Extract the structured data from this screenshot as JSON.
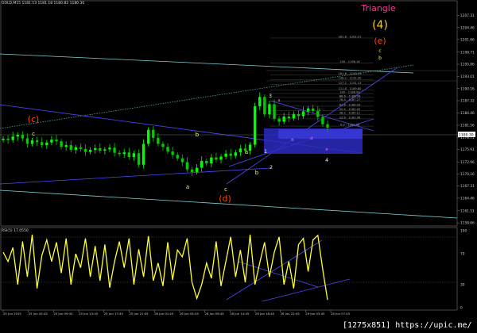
{
  "header": {
    "caption": "GOLD,M15  1181.13 1181.18 1180.82 1180.30"
  },
  "rsi": {
    "caption": "RSI(5) 17.0550"
  },
  "watermark": "[1275x851] https://upic.me/",
  "colors": {
    "background": "#000000",
    "bull_candle": "#00ff00",
    "bear_candle": "#00cc00",
    "rsi_line": "#ffff33",
    "channel_line": "#4a4aff",
    "long_trend": "#7fd0d0",
    "highlight_box": "#2b2bbf",
    "triangle_label": "#ff3399",
    "wave_4": "#ffcc00",
    "wave_abc": "#e0ff66",
    "wave_degree_paren": "#ff4500",
    "price_tag_bg": "#ffffff"
  },
  "chart_data": {
    "type": "line",
    "symbol": "GOLD",
    "timeframe": "M15",
    "price_axis": {
      "ylim": [
        1158.5,
        1210.0
      ],
      "ticks": [
        "1207.31",
        "1204.46",
        "1201.66",
        "1198.71",
        "1195.86",
        "1193.01",
        "1190.16",
        "1187.32",
        "1184.46",
        "1181.56",
        "1178.71",
        "1175.91",
        "1172.96",
        "1170.16",
        "1167.31",
        "1164.46",
        "1161.51",
        "1158.66"
      ],
      "current_price": "1180.30"
    },
    "time_axis": {
      "ticks": [
        "25 Jun 2015",
        "25 Jun 05:45",
        "25 Jun 09:45",
        "25 Jun 13:45",
        "25 Jun 17:45",
        "25 Jun 21:45",
        "26 Jun 01:45",
        "26 Jun 05:45",
        "26 Jun 09:45",
        "26 Jun 14:45",
        "26 Jun 18:45",
        "26 Jun 22:45",
        "29 Jun 03:45",
        "29 Jun 07:45"
      ]
    },
    "close_series": [
      1178.4,
      1178.1,
      1178.9,
      1179.3,
      1178.5,
      1177.2,
      1178.0,
      1177.6,
      1176.9,
      1177.5,
      1178.2,
      1177.8,
      1176.5,
      1176.9,
      1175.8,
      1176.4,
      1176.0,
      1175.3,
      1175.8,
      1176.2,
      1175.6,
      1175.9,
      1176.3,
      1175.1,
      1174.8,
      1175.2,
      1174.1,
      1175.0,
      1172.3,
      1177.2,
      1180.5,
      1178.6,
      1177.2,
      1176.5,
      1175.4,
      1174.6,
      1173.8,
      1172.9,
      1171.2,
      1170.6,
      1171.6,
      1173.2,
      1172.6,
      1174.0,
      1173.5,
      1174.2,
      1174.9,
      1174.4,
      1175.2,
      1176.1,
      1175.6,
      1177.0,
      1186.0,
      1188.2,
      1184.1,
      1186.5,
      1183.1,
      1182.4,
      1183.6,
      1183.2,
      1184.2,
      1183.7,
      1184.8,
      1185.5,
      1184.9,
      1183.5,
      1181.8,
      1181.0
    ],
    "rsi_axis": {
      "ylim": [
        0,
        100
      ],
      "ticks": [
        "100",
        "70",
        "30",
        "0"
      ],
      "current": 17.055
    },
    "rsi_series": [
      72,
      60,
      78,
      30,
      86,
      40,
      95,
      25,
      68,
      88,
      60,
      85,
      45,
      90,
      30,
      70,
      52,
      90,
      40,
      80,
      35,
      82,
      26,
      60,
      86,
      52,
      90,
      30,
      76,
      40,
      93,
      35,
      58,
      28,
      85,
      36,
      75,
      66,
      90,
      33,
      12,
      30,
      58,
      38,
      86,
      28,
      60,
      92,
      40,
      75,
      33,
      95,
      30,
      58,
      85,
      40,
      72,
      92,
      30,
      60,
      25,
      82,
      90,
      47,
      88,
      94,
      50,
      10
    ],
    "fib_levels": [
      "261.8 - 1202.01",
      "100 - 1196.16",
      "161.8 - 1193.33",
      "138.2 - 1192.30",
      "127.2 - 1191.13",
      "111.8 - 1189.80",
      "100 - 1188.99",
      "88.6 - 1188.08",
      "76.4 - 1187.27",
      "61.8 - 1186.03",
      "50.0 - 1185.00",
      "38.2 - 1184.12",
      "23.6 - 1183.06",
      "0.0 - 1181.36"
    ],
    "annotations": {
      "pattern": "Triangle",
      "wave_degree": "(4)",
      "wave_e": "(e)",
      "wave_e_c": "c",
      "wave_e_b": "b",
      "wave_c": "(c)",
      "wave_c_label": "c",
      "wave_d": "(d)",
      "wave_d_a": "a",
      "wave_d_b": "b",
      "wave_d_c": "c",
      "wave_a2": "a",
      "wave_b2": "b",
      "wave_1": "1",
      "wave_2": "2",
      "wave_3": "3",
      "wave_4": "4",
      "wave_a3": "a",
      "wave_b3": "b",
      "wave_c3": "c",
      "wave_d3": "d",
      "wave_e3": "e"
    }
  }
}
